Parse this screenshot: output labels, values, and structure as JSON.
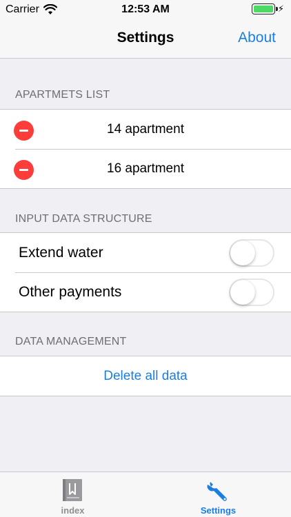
{
  "status": {
    "carrier": "Carrier",
    "time": "12:53 AM",
    "battery_level": 1.0,
    "charging": true
  },
  "nav": {
    "title": "Settings",
    "right_button": "About"
  },
  "sections": {
    "apartments": {
      "header": "APARTMETS LIST",
      "items": [
        {
          "label": "14 apartment"
        },
        {
          "label": "16 apartment"
        }
      ]
    },
    "input_structure": {
      "header": "INPUT DATA STRUCTURE",
      "toggles": [
        {
          "label": "Extend water",
          "on": false
        },
        {
          "label": "Other payments",
          "on": false
        }
      ]
    },
    "data_management": {
      "header": "DATA MANAGEMENT",
      "action": "Delete all data"
    }
  },
  "tabs": [
    {
      "label": "index",
      "icon": "bookmark-book-icon",
      "selected": false
    },
    {
      "label": "Settings",
      "icon": "wrench-icon",
      "selected": true
    }
  ],
  "colors": {
    "accent": "#1a7ee0",
    "delete": "#fc3d39",
    "battery": "#4cd964"
  }
}
